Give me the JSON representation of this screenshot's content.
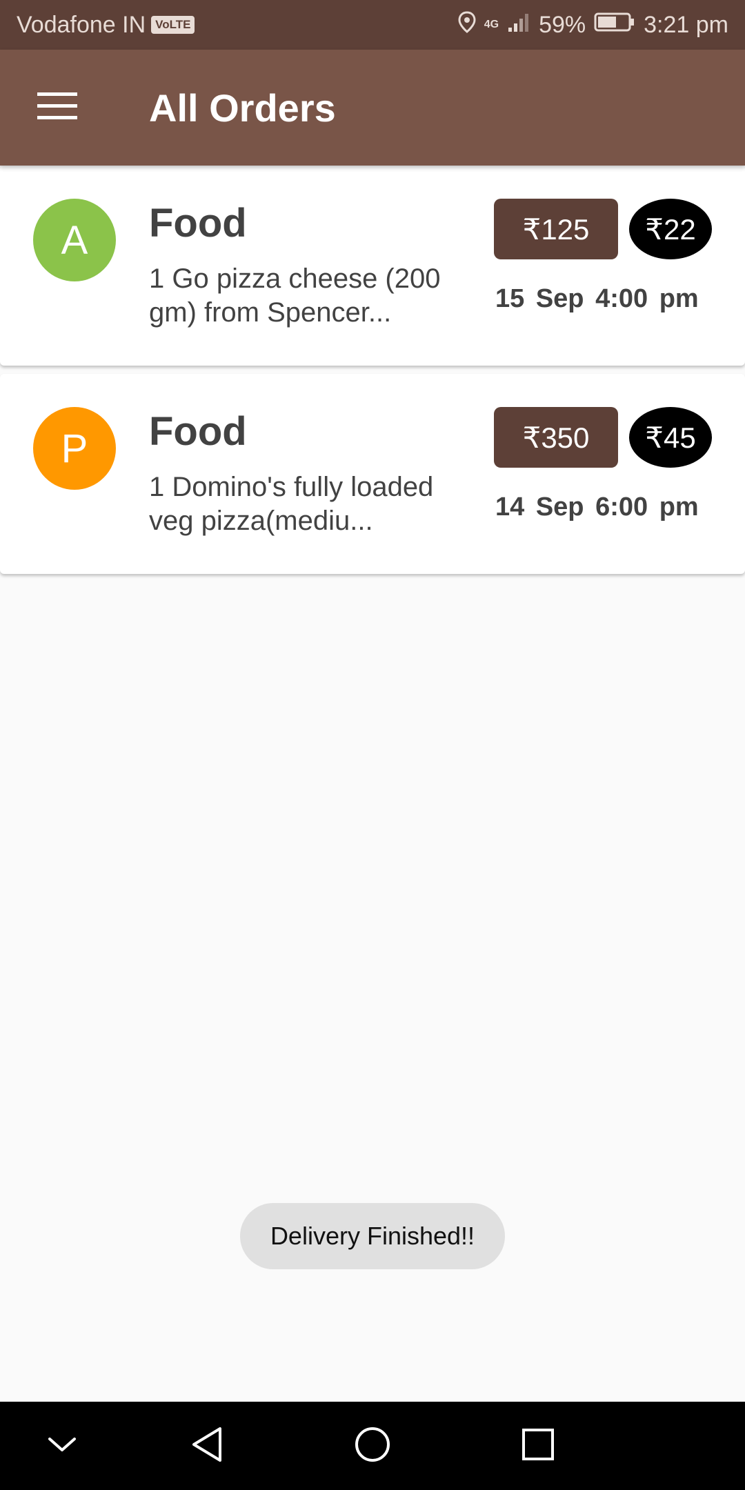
{
  "status_bar": {
    "carrier": "Vodafone IN",
    "volte": "VoLTE",
    "network": "4G",
    "battery": "59%",
    "time": "3:21 pm"
  },
  "app_bar": {
    "title": "All Orders",
    "menu_icon": "hamburger-menu-icon"
  },
  "orders": [
    {
      "avatar_letter": "A",
      "avatar_color": "#8bc34a",
      "title": "Food",
      "description": "1 Go pizza cheese (200 gm) from Spencer...",
      "price": "₹125",
      "tip": "₹22",
      "date": "15 Sep",
      "time": "4:00 pm"
    },
    {
      "avatar_letter": "P",
      "avatar_color": "#ff9800",
      "title": "Food",
      "description": "1 Domino's fully loaded veg pizza(mediu...",
      "price": "₹350",
      "tip": "₹45",
      "date": "14 Sep",
      "time": "6:00 pm"
    }
  ],
  "toast": {
    "message": "Delivery Finished!!"
  },
  "colors": {
    "status_bar": "#5d4037",
    "app_bar": "#795548",
    "price_chip": "#5d4037",
    "tip_chip": "#000000"
  }
}
